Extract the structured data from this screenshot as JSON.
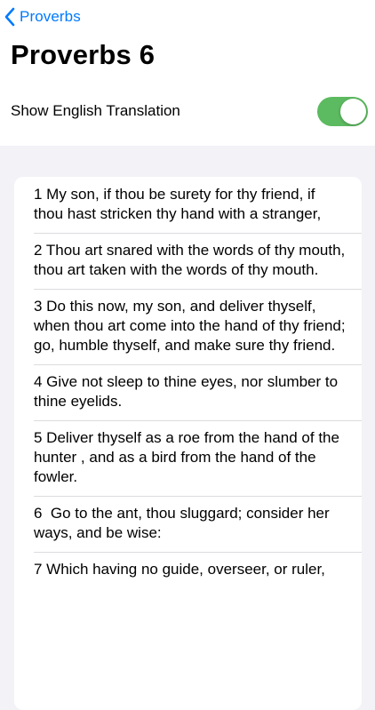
{
  "nav": {
    "back_label": "Proverbs",
    "back_icon": "chevron-left-icon"
  },
  "title": "Proverbs 6",
  "translation_toggle": {
    "label": "Show English Translation",
    "on": true,
    "color": "#5cba60"
  },
  "colors": {
    "accent": "#007aff",
    "background": "#f2f2f7",
    "card": "#ffffff"
  },
  "verses": [
    {
      "text": "1 My son, if thou be surety for thy friend, if thou hast stricken thy hand with a stranger,"
    },
    {
      "text": "2 Thou art snared with the words of thy mouth, thou art taken with the words of thy mouth."
    },
    {
      "text": "3 Do this now, my son, and deliver thyself, when thou art come into the hand of thy friend; go, humble thyself, and make sure thy friend."
    },
    {
      "text": "4 Give not sleep to thine eyes, nor slumber to thine eyelids."
    },
    {
      "text": "5 Deliver thyself as a roe from the hand of the hunter , and as a bird from the hand of the fowler."
    },
    {
      "text": "6  Go to the ant, thou sluggard; consider her ways, and be wise:"
    },
    {
      "text": "7 Which having no guide, overseer, or ruler,"
    }
  ]
}
